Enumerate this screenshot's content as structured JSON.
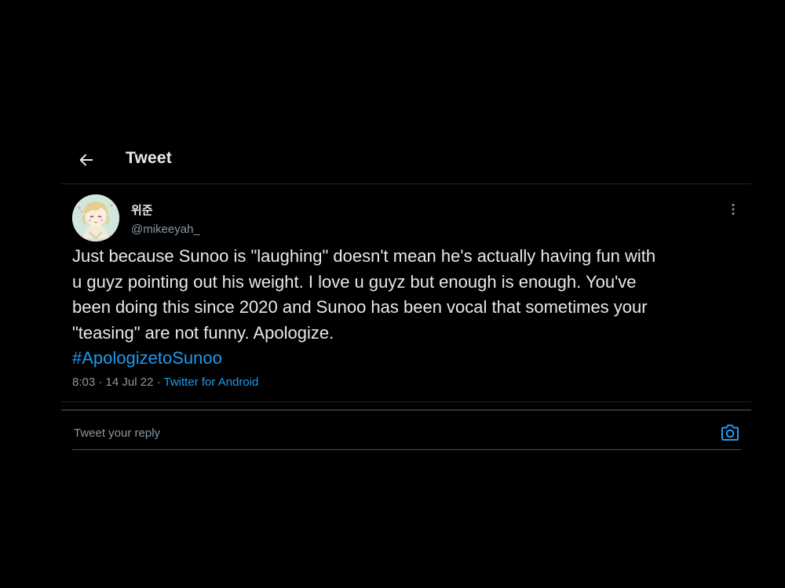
{
  "header": {
    "title": "Tweet"
  },
  "tweet": {
    "display_name": "위준",
    "handle": "@mikeeyah_",
    "text": "Just because Sunoo is \"laughing\" doesn't mean he's actually having fun with\nu guyz pointing out his weight. I love u guyz but enough is enough. You've\nbeen doing this since 2020 and Sunoo has been vocal that sometimes your\n\"teasing\" are not funny. Apologize.",
    "hashtag": "#ApologizetoSunoo",
    "time": "8:03",
    "separator": "·",
    "date": "14 Jul 22",
    "source": "Twitter for Android"
  },
  "reply": {
    "placeholder": "Tweet your reply"
  },
  "icons": {
    "back": "arrow-left-icon",
    "more": "more-vertical-icon",
    "camera": "camera-icon"
  },
  "colors": {
    "background": "#000000",
    "text": "#e7e9ea",
    "muted": "#8b98a5",
    "accent": "#1d9bf0",
    "border": "#2f3336"
  }
}
